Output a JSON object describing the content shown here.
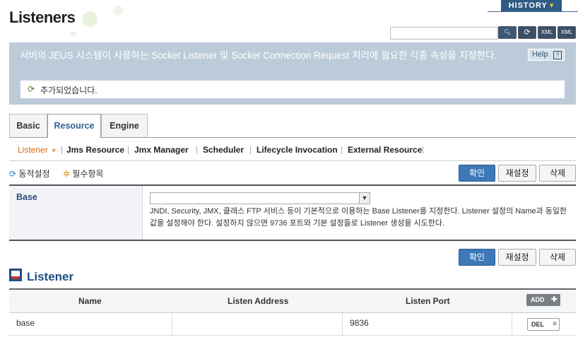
{
  "page": {
    "title": "Listeners",
    "history_label": "HISTORY"
  },
  "toolbar": {
    "search_value": "",
    "icons": [
      "search-icon",
      "refresh-icon",
      "xml-export-icon",
      "xml-import-icon"
    ]
  },
  "banner": {
    "description": "서버의 JEUS 시스템이 사용하는 Socket Listener 및 Socket Connection Request 처리에 필요한 각종 속성을 지정한다.",
    "help_label": "Help",
    "message": "추가되었습니다."
  },
  "tabs": [
    {
      "label": "Basic",
      "active": false
    },
    {
      "label": "Resource",
      "active": true
    },
    {
      "label": "Engine",
      "active": false
    }
  ],
  "subtabs": [
    {
      "label": "Listener",
      "active": true
    },
    {
      "label": "Jms Resource",
      "active": false
    },
    {
      "label": "Jmx Manager",
      "active": false
    },
    {
      "label": "Scheduler",
      "active": false
    },
    {
      "label": "Lifecycle Invocation",
      "active": false
    },
    {
      "label": "External Resource",
      "active": false
    }
  ],
  "legend": {
    "dynamic": "동적설정",
    "required": "필수항목"
  },
  "actions": {
    "confirm": "확인",
    "reset": "재설정",
    "delete": "삭제"
  },
  "form": {
    "base_label": "Base",
    "base_value": "",
    "base_desc": "JNDI, Security, JMX, 클래스 FTP 서비스 등이 기본적으로 이용하는 Base Listener를 지정한다. Listener 설정의 Name과 동일한 값을 설정해야 한다. 설정하지 않으면 9736 포트와 기본 설정들로 Listener 생성을 시도한다."
  },
  "listener_section": {
    "title": "Listener",
    "columns": [
      "Name",
      "Listen Address",
      "Listen Port"
    ],
    "add_label": "ADD",
    "rows": [
      {
        "name": "base",
        "address": "",
        "port": "9836",
        "del_label": "DEL"
      }
    ]
  },
  "colors": {
    "accent": "#2d6496",
    "banner": "#bccbd9",
    "primary_button": "#3d78b8",
    "active_subtab": "#d86a10"
  }
}
